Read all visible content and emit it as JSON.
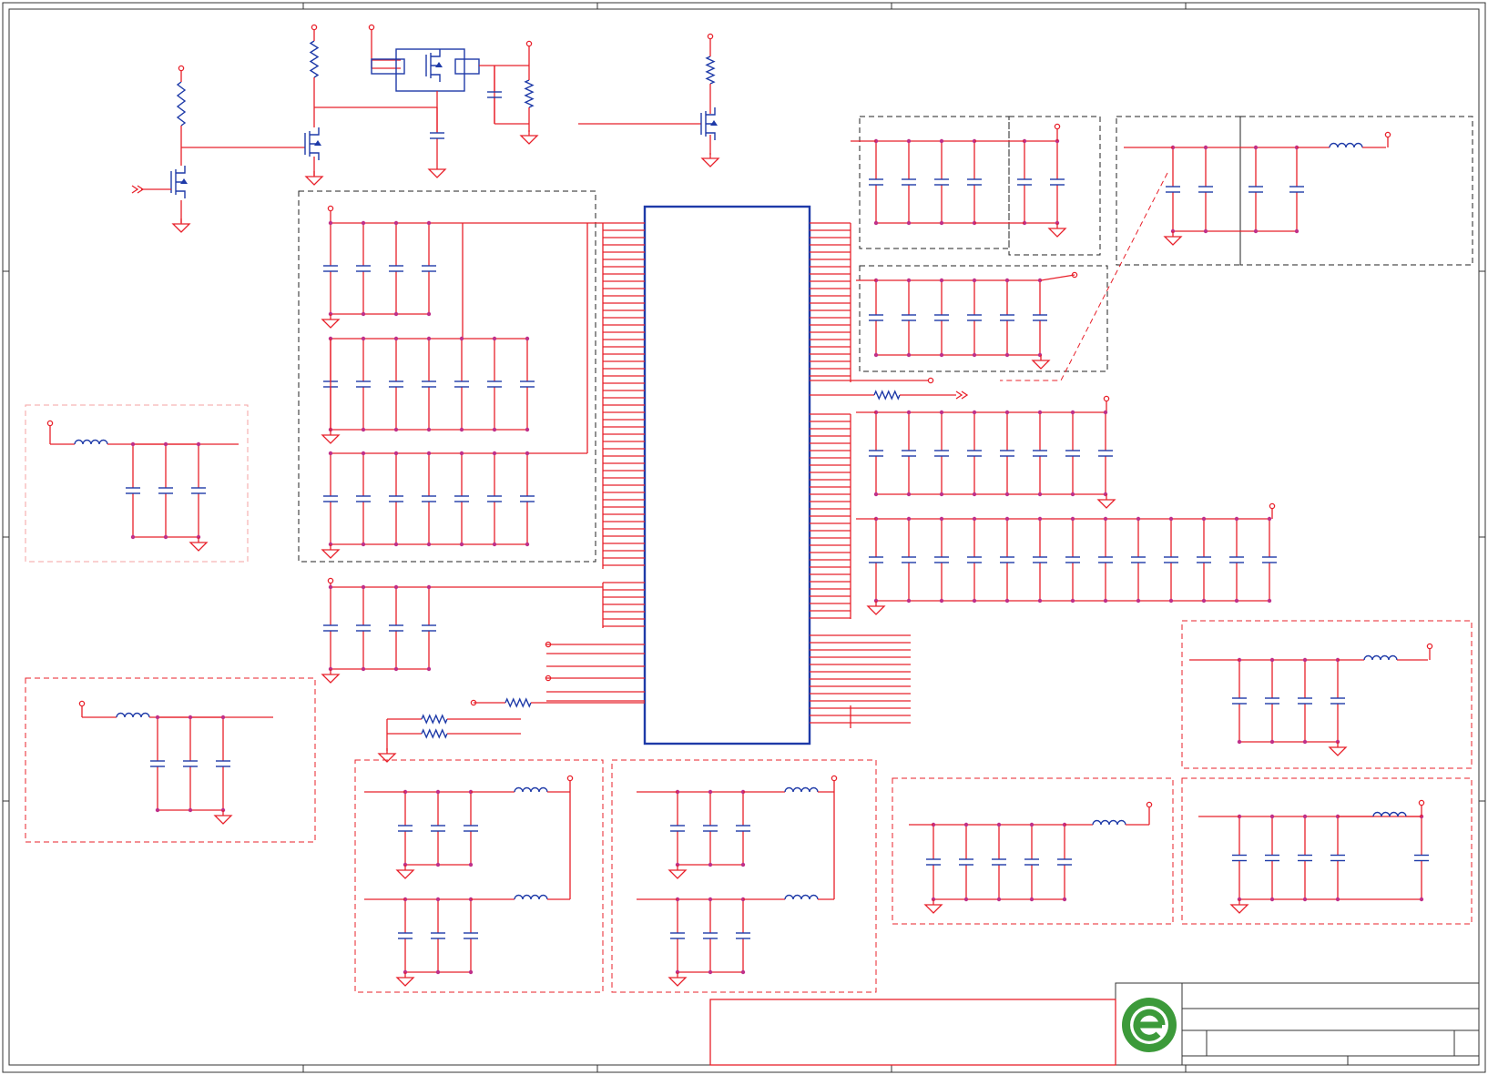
{
  "sheet": {
    "colors": {
      "wire": "#e8202a",
      "component": "#1e3aa8",
      "junction": "#c0308a",
      "frame": "#333333",
      "logo_green": "#3c9a3a"
    }
  },
  "title_block": {
    "logo_icon": "green-circle-e-logo-icon"
  }
}
